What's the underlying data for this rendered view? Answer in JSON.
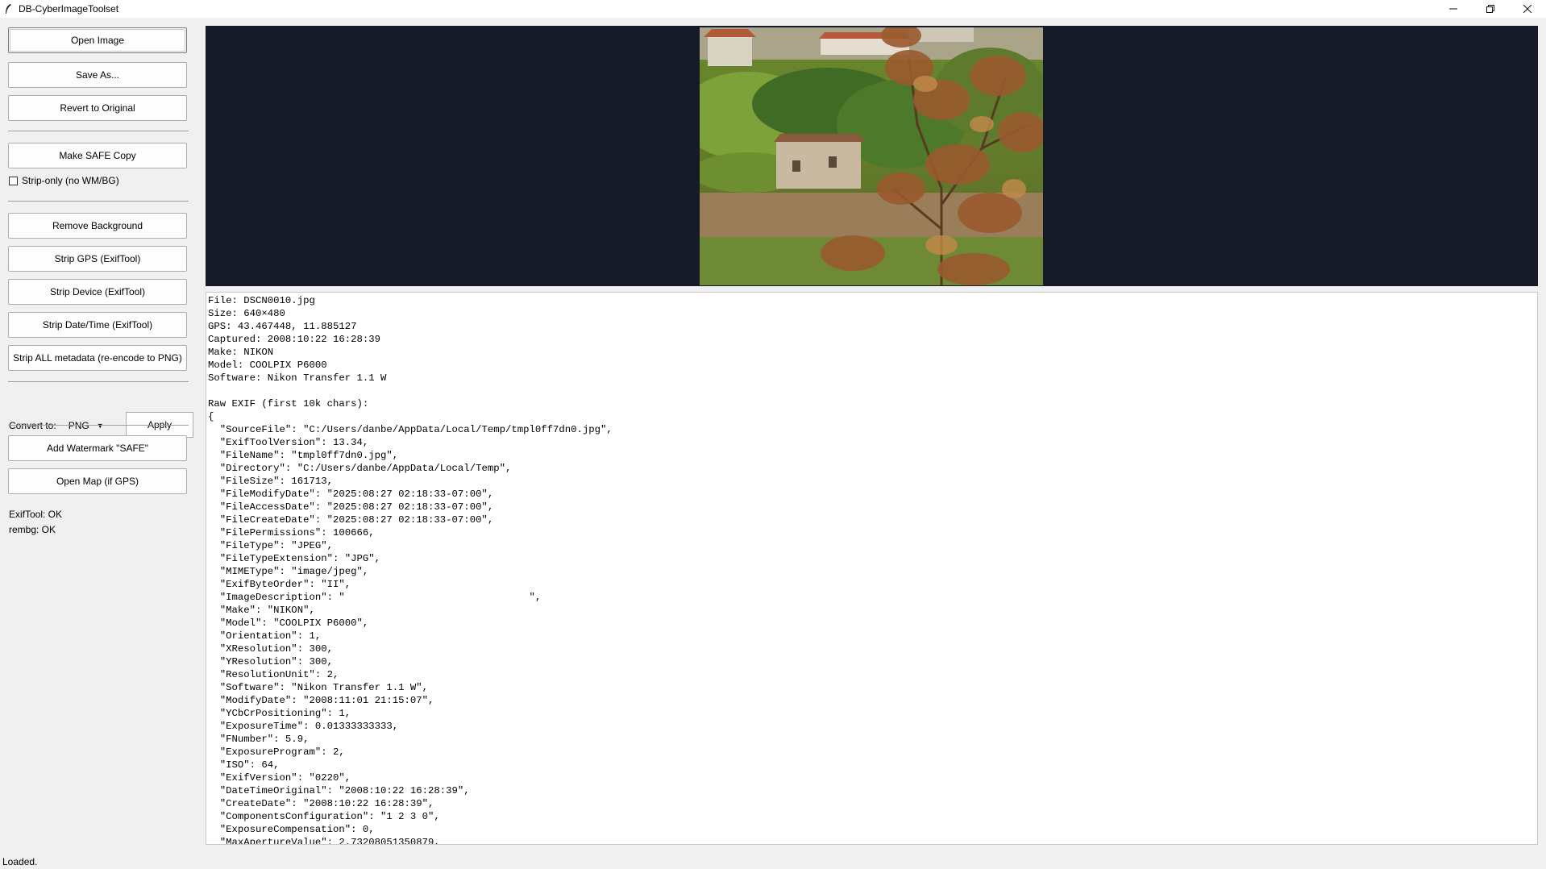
{
  "window": {
    "title": "DB-CyberImageToolset",
    "icons": {
      "app": "feather-icon",
      "minimize": "minimize-icon",
      "maximize": "restore-icon",
      "close": "close-icon"
    }
  },
  "sidebar": {
    "open_image": "Open Image",
    "save_as": "Save As...",
    "revert": "Revert to Original",
    "make_safe": "Make SAFE Copy",
    "strip_only": "Strip-only (no WM/BG)",
    "remove_bg": "Remove Background",
    "strip_gps": "Strip GPS (ExifTool)",
    "strip_device": "Strip Device (ExifTool)",
    "strip_datetime": "Strip Date/Time (ExifTool)",
    "strip_all": "Strip ALL metadata (re-encode to PNG)",
    "convert_label": "Convert to:",
    "convert_value": "PNG",
    "apply": "Apply",
    "add_watermark": "Add Watermark \"SAFE\"",
    "open_map": "Open Map (if GPS)",
    "exiftool_status": "ExifTool: OK",
    "rembg_status": "rembg: OK"
  },
  "metadata_text": "File: DSCN0010.jpg\nSize: 640×480\nGPS: 43.467448, 11.885127\nCaptured: 2008:10:22 16:28:39\nMake: NIKON\nModel: COOLPIX P6000\nSoftware: Nikon Transfer 1.1 W\n\nRaw EXIF (first 10k chars):\n{\n  \"SourceFile\": \"C:/Users/danbe/AppData/Local/Temp/tmpl0ff7dn0.jpg\",\n  \"ExifToolVersion\": 13.34,\n  \"FileName\": \"tmpl0ff7dn0.jpg\",\n  \"Directory\": \"C:/Users/danbe/AppData/Local/Temp\",\n  \"FileSize\": 161713,\n  \"FileModifyDate\": \"2025:08:27 02:18:33-07:00\",\n  \"FileAccessDate\": \"2025:08:27 02:18:33-07:00\",\n  \"FileCreateDate\": \"2025:08:27 02:18:33-07:00\",\n  \"FilePermissions\": 100666,\n  \"FileType\": \"JPEG\",\n  \"FileTypeExtension\": \"JPG\",\n  \"MIMEType\": \"image/jpeg\",\n  \"ExifByteOrder\": \"II\",\n  \"ImageDescription\": \"                               \",\n  \"Make\": \"NIKON\",\n  \"Model\": \"COOLPIX P6000\",\n  \"Orientation\": 1,\n  \"XResolution\": 300,\n  \"YResolution\": 300,\n  \"ResolutionUnit\": 2,\n  \"Software\": \"Nikon Transfer 1.1 W\",\n  \"ModifyDate\": \"2008:11:01 21:15:07\",\n  \"YCbCrPositioning\": 1,\n  \"ExposureTime\": 0.01333333333,\n  \"FNumber\": 5.9,\n  \"ExposureProgram\": 2,\n  \"ISO\": 64,\n  \"ExifVersion\": \"0220\",\n  \"DateTimeOriginal\": \"2008:10:22 16:28:39\",\n  \"CreateDate\": \"2008:10:22 16:28:39\",\n  \"ComponentsConfiguration\": \"1 2 3 0\",\n  \"ExposureCompensation\": 0,\n  \"MaxApertureValue\": 2.73208051350879,",
  "status_bar": "Loaded."
}
